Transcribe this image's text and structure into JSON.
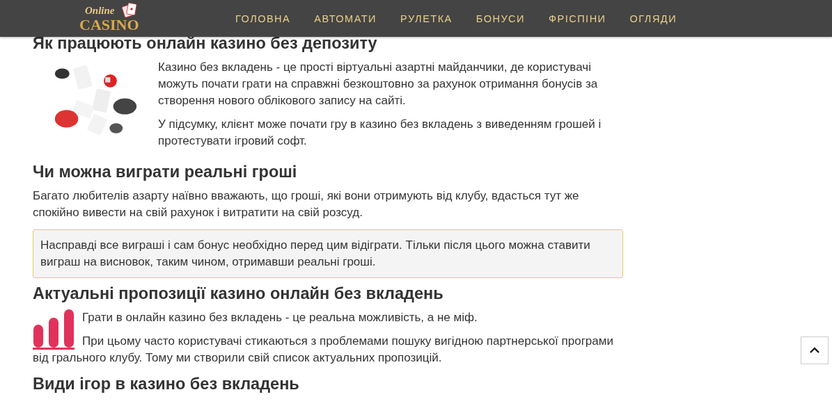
{
  "header": {
    "logo": {
      "line1": "Online",
      "line2": "CASINO"
    },
    "nav": [
      {
        "label": "ГОЛОВНА"
      },
      {
        "label": "АВТОМАТИ"
      },
      {
        "label": "РУЛЕТКА"
      },
      {
        "label": "БОНУСИ"
      },
      {
        "label": "ФРІСПІНИ"
      },
      {
        "label": "ОГЛЯДИ"
      }
    ]
  },
  "sections": [
    {
      "heading": "Як працюють онлайн казино без депозиту",
      "kind": "picture",
      "paragraphs": [
        "Казино без вкладень - це прості віртуальні азартні майданчики, де користувачі можуть почати грати на справжні безкоштовно за рахунок отримання бонусів за створення нового облікового запису на сайті.",
        "У підсумку, клієнт може почати гру в казино без вкладень з виведенням грошей і протестувати ігровий софт."
      ]
    },
    {
      "heading": "Чи можна виграти реальні гроші",
      "kind": "plain",
      "paragraphs": [
        "Багато любителів азарту наївно вважають, що гроші, які вони отримують від клубу, вдасться тут же спокійно вивести на свій рахунок і витратити на свій розсуд."
      ],
      "callout": "Насправді все виграші і сам бонус необхідно перед цим відіграти. Тільки після цього можна ставити виграш на висновок, таким чином, отримавши реальні гроші."
    },
    {
      "heading": "Актуальні пропозиції казино онлайн без вкладень",
      "kind": "icon",
      "paragraphs": [
        "Грати в онлайн казино без вкладень - це реальна можливість, а не міф.",
        "При цьому часто користувачі стикаються з проблемами пошуку вигідною партнерської програми від грального клубу. Тому ми створили свій список актуальних пропозицій."
      ]
    },
    {
      "heading": "Види ігор в казино без вкладень",
      "kind": "plain"
    }
  ]
}
